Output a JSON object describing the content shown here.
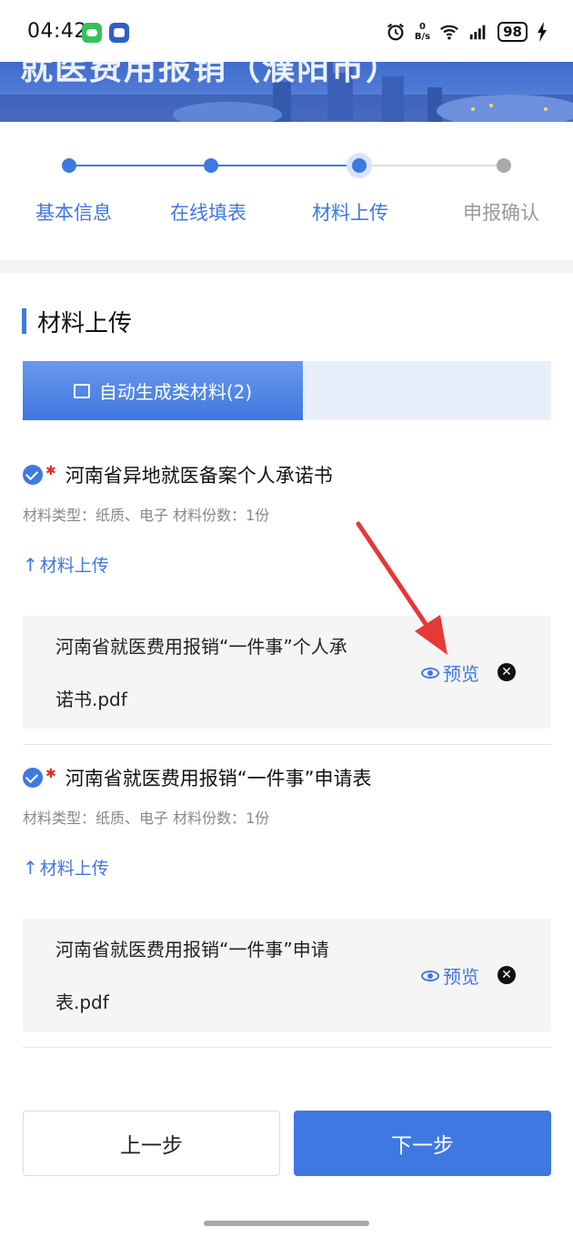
{
  "status_bar": {
    "time": "04:42",
    "speed_value": "0",
    "speed_unit": "B/s",
    "battery": "98"
  },
  "banner": {
    "title": "就医费用报销（濮阳市）"
  },
  "steps": [
    {
      "label": "基本信息",
      "state": "done"
    },
    {
      "label": "在线填表",
      "state": "done"
    },
    {
      "label": "材料上传",
      "state": "current"
    },
    {
      "label": "申报确认",
      "state": "pending"
    }
  ],
  "section": {
    "title": "材料上传",
    "tab_label": "自动生成类材料(2)"
  },
  "materials": [
    {
      "title": "河南省异地就医备案个人承诺书",
      "meta": "材料类型：纸质、电子 材料份数：1份",
      "upload_label": "材料上传",
      "file_line1": "河南省就医费用报销“一件事”个人承",
      "file_line2": "诺书.pdf",
      "preview_label": "预览"
    },
    {
      "title": "河南省就医费用报销“一件事”申请表",
      "meta": "材料类型：纸质、电子 材料份数：1份",
      "upload_label": "材料上传",
      "file_line1": "河南省就医费用报销“一件事”申请",
      "file_line2": "表.pdf",
      "preview_label": "预览"
    }
  ],
  "buttons": {
    "prev": "上一步",
    "next": "下一步"
  },
  "colors": {
    "accent": "#3f78e0",
    "required_star": "#e02a2a",
    "annotation_arrow": "#e53935"
  }
}
